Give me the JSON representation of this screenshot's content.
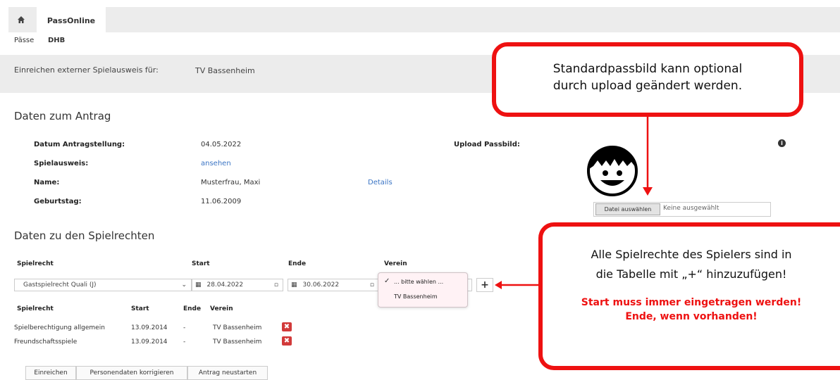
{
  "nav": {
    "app_tab": "PassOnline"
  },
  "breadcrumb": {
    "item1": "Pässe",
    "item2": "DHB"
  },
  "banner": {
    "label": "Einreichen externer Spielausweis für:",
    "club": "TV Bassenheim"
  },
  "antrag": {
    "title": "Daten zum Antrag",
    "fields": [
      {
        "label": "Datum Antragstellung:",
        "value": "04.05.2022"
      },
      {
        "label": "Spielausweis:",
        "value": "ansehen"
      },
      {
        "label": "Name:",
        "value": "Musterfrau, Maxi"
      },
      {
        "label": "Geburtstag:",
        "value": "11.06.2009"
      }
    ],
    "details_link": "Details",
    "upload_label": "Upload Passbild:",
    "file_button": "Datei auswählen",
    "file_status": "Keine ausgewählt"
  },
  "spielrechte": {
    "title": "Daten zu den Spielrechten",
    "headers": {
      "spielrecht": "Spielrecht",
      "start": "Start",
      "ende": "Ende",
      "verein": "Verein"
    },
    "form": {
      "spielrecht_value": "Gastspielrecht Quali (J)",
      "start_value": "28.04.2022",
      "ende_value": "30.06.2022",
      "add": "+"
    },
    "dropdown": {
      "selected": "... bitte wählen ...",
      "option": "TV Bassenheim"
    },
    "table_headers": {
      "spielrecht": "Spielrecht",
      "start": "Start",
      "ende": "Ende",
      "verein": "Verein"
    },
    "rows": [
      {
        "spielrecht": "Spielberechtigung allgemein",
        "start": "13.09.2014",
        "ende": "-",
        "verein": "TV Bassenheim"
      },
      {
        "spielrecht": "Freundschaftsspiele",
        "start": "13.09.2014",
        "ende": "-",
        "verein": "TV Bassenheim"
      }
    ]
  },
  "buttons": {
    "submit": "Einreichen",
    "correct": "Personendaten korrigieren",
    "restart": "Antrag neustarten"
  },
  "callouts": {
    "top_line1": "Standardpassbild kann optional",
    "top_line2": "durch upload geändert werden.",
    "right_line1": "Alle Spielrechte des Spielers sind in",
    "right_line2": "die Tabelle mit „+“ hinzuzufügen!",
    "right_warn1": "Start muss immer eingetragen werden!",
    "right_warn2": "Ende, wenn vorhanden!"
  },
  "colors": {
    "accent_red": "#ee1111",
    "link_blue": "#3a74c4",
    "delete_red": "#d23a3a"
  }
}
